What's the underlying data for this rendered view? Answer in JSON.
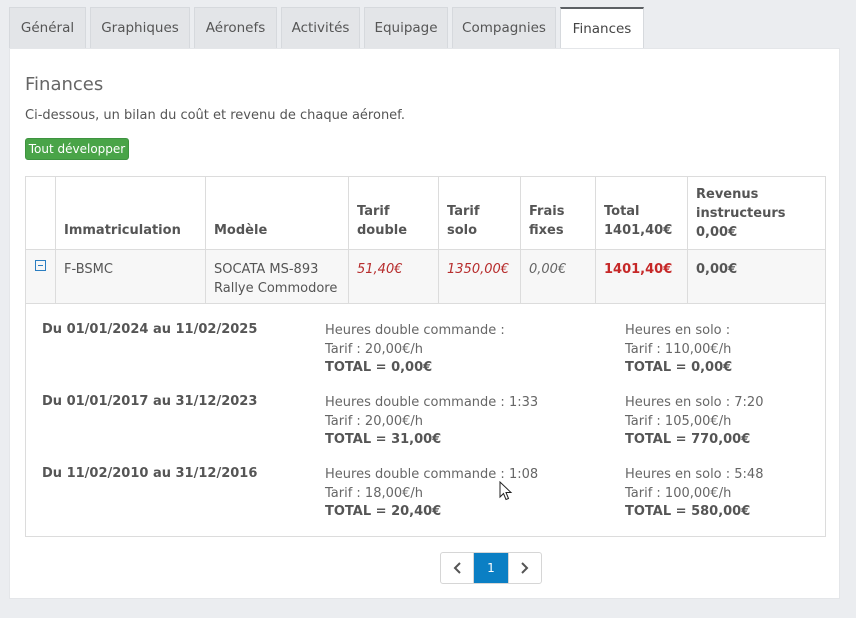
{
  "tabs": [
    "Général",
    "Graphiques",
    "Aéronefs",
    "Activités",
    "Equipage",
    "Compagnies",
    "Finances"
  ],
  "active_tab": "Finances",
  "page": {
    "title": "Finances",
    "description": "Ci-dessous, un bilan du coût et revenu de chaque aéronef.",
    "expand_button": "Tout développer"
  },
  "table": {
    "headers": {
      "immatriculation": "Immatriculation",
      "modele": "Modèle",
      "tarif_double": "Tarif\ndouble",
      "tarif_solo": "Tarif\nsolo",
      "frais_fixes": "Frais\nfixes",
      "total": "Total\n1401,40€",
      "revenus": "Revenus\ninstructeurs\n0,00€"
    },
    "row": {
      "immatriculation": "F-BSMC",
      "modele": "SOCATA MS-893\nRallye Commodore",
      "tarif_double": "51,40€",
      "tarif_solo": "1350,00€",
      "frais_fixes": "0,00€",
      "total": "1401,40€",
      "revenus": "0,00€"
    }
  },
  "periods": [
    {
      "range": "Du 01/01/2024 au 11/02/2025",
      "double": "Heures double commande :",
      "double_tarif": "Tarif : 20,00€/h",
      "double_total": "TOTAL = 0,00€",
      "solo": "Heures en solo :",
      "solo_tarif": "Tarif : 110,00€/h",
      "solo_total": "TOTAL = 0,00€"
    },
    {
      "range": "Du 01/01/2017 au 31/12/2023",
      "double": "Heures double commande : 1:33",
      "double_tarif": "Tarif : 20,00€/h",
      "double_total": "TOTAL = 31,00€",
      "solo": "Heures en solo : 7:20",
      "solo_tarif": "Tarif : 105,00€/h",
      "solo_total": "TOTAL = 770,00€"
    },
    {
      "range": "Du 11/02/2010 au 31/12/2016",
      "double": "Heures double commande : 1:08",
      "double_tarif": "Tarif : 18,00€/h",
      "double_total": "TOTAL = 20,40€",
      "solo": "Heures en solo : 5:48",
      "solo_tarif": "Tarif : 100,00€/h",
      "solo_total": "TOTAL = 580,00€"
    }
  ],
  "pagination": {
    "current": "1"
  },
  "icons": {
    "collapse": "minus-square-icon",
    "prev": "chevron-left-icon",
    "next": "chevron-right-icon",
    "cursor": "mouse-pointer-icon"
  },
  "colors": {
    "accent": "#0b7fc4",
    "expand_button": "#49a448",
    "price": "#b72d2d"
  }
}
